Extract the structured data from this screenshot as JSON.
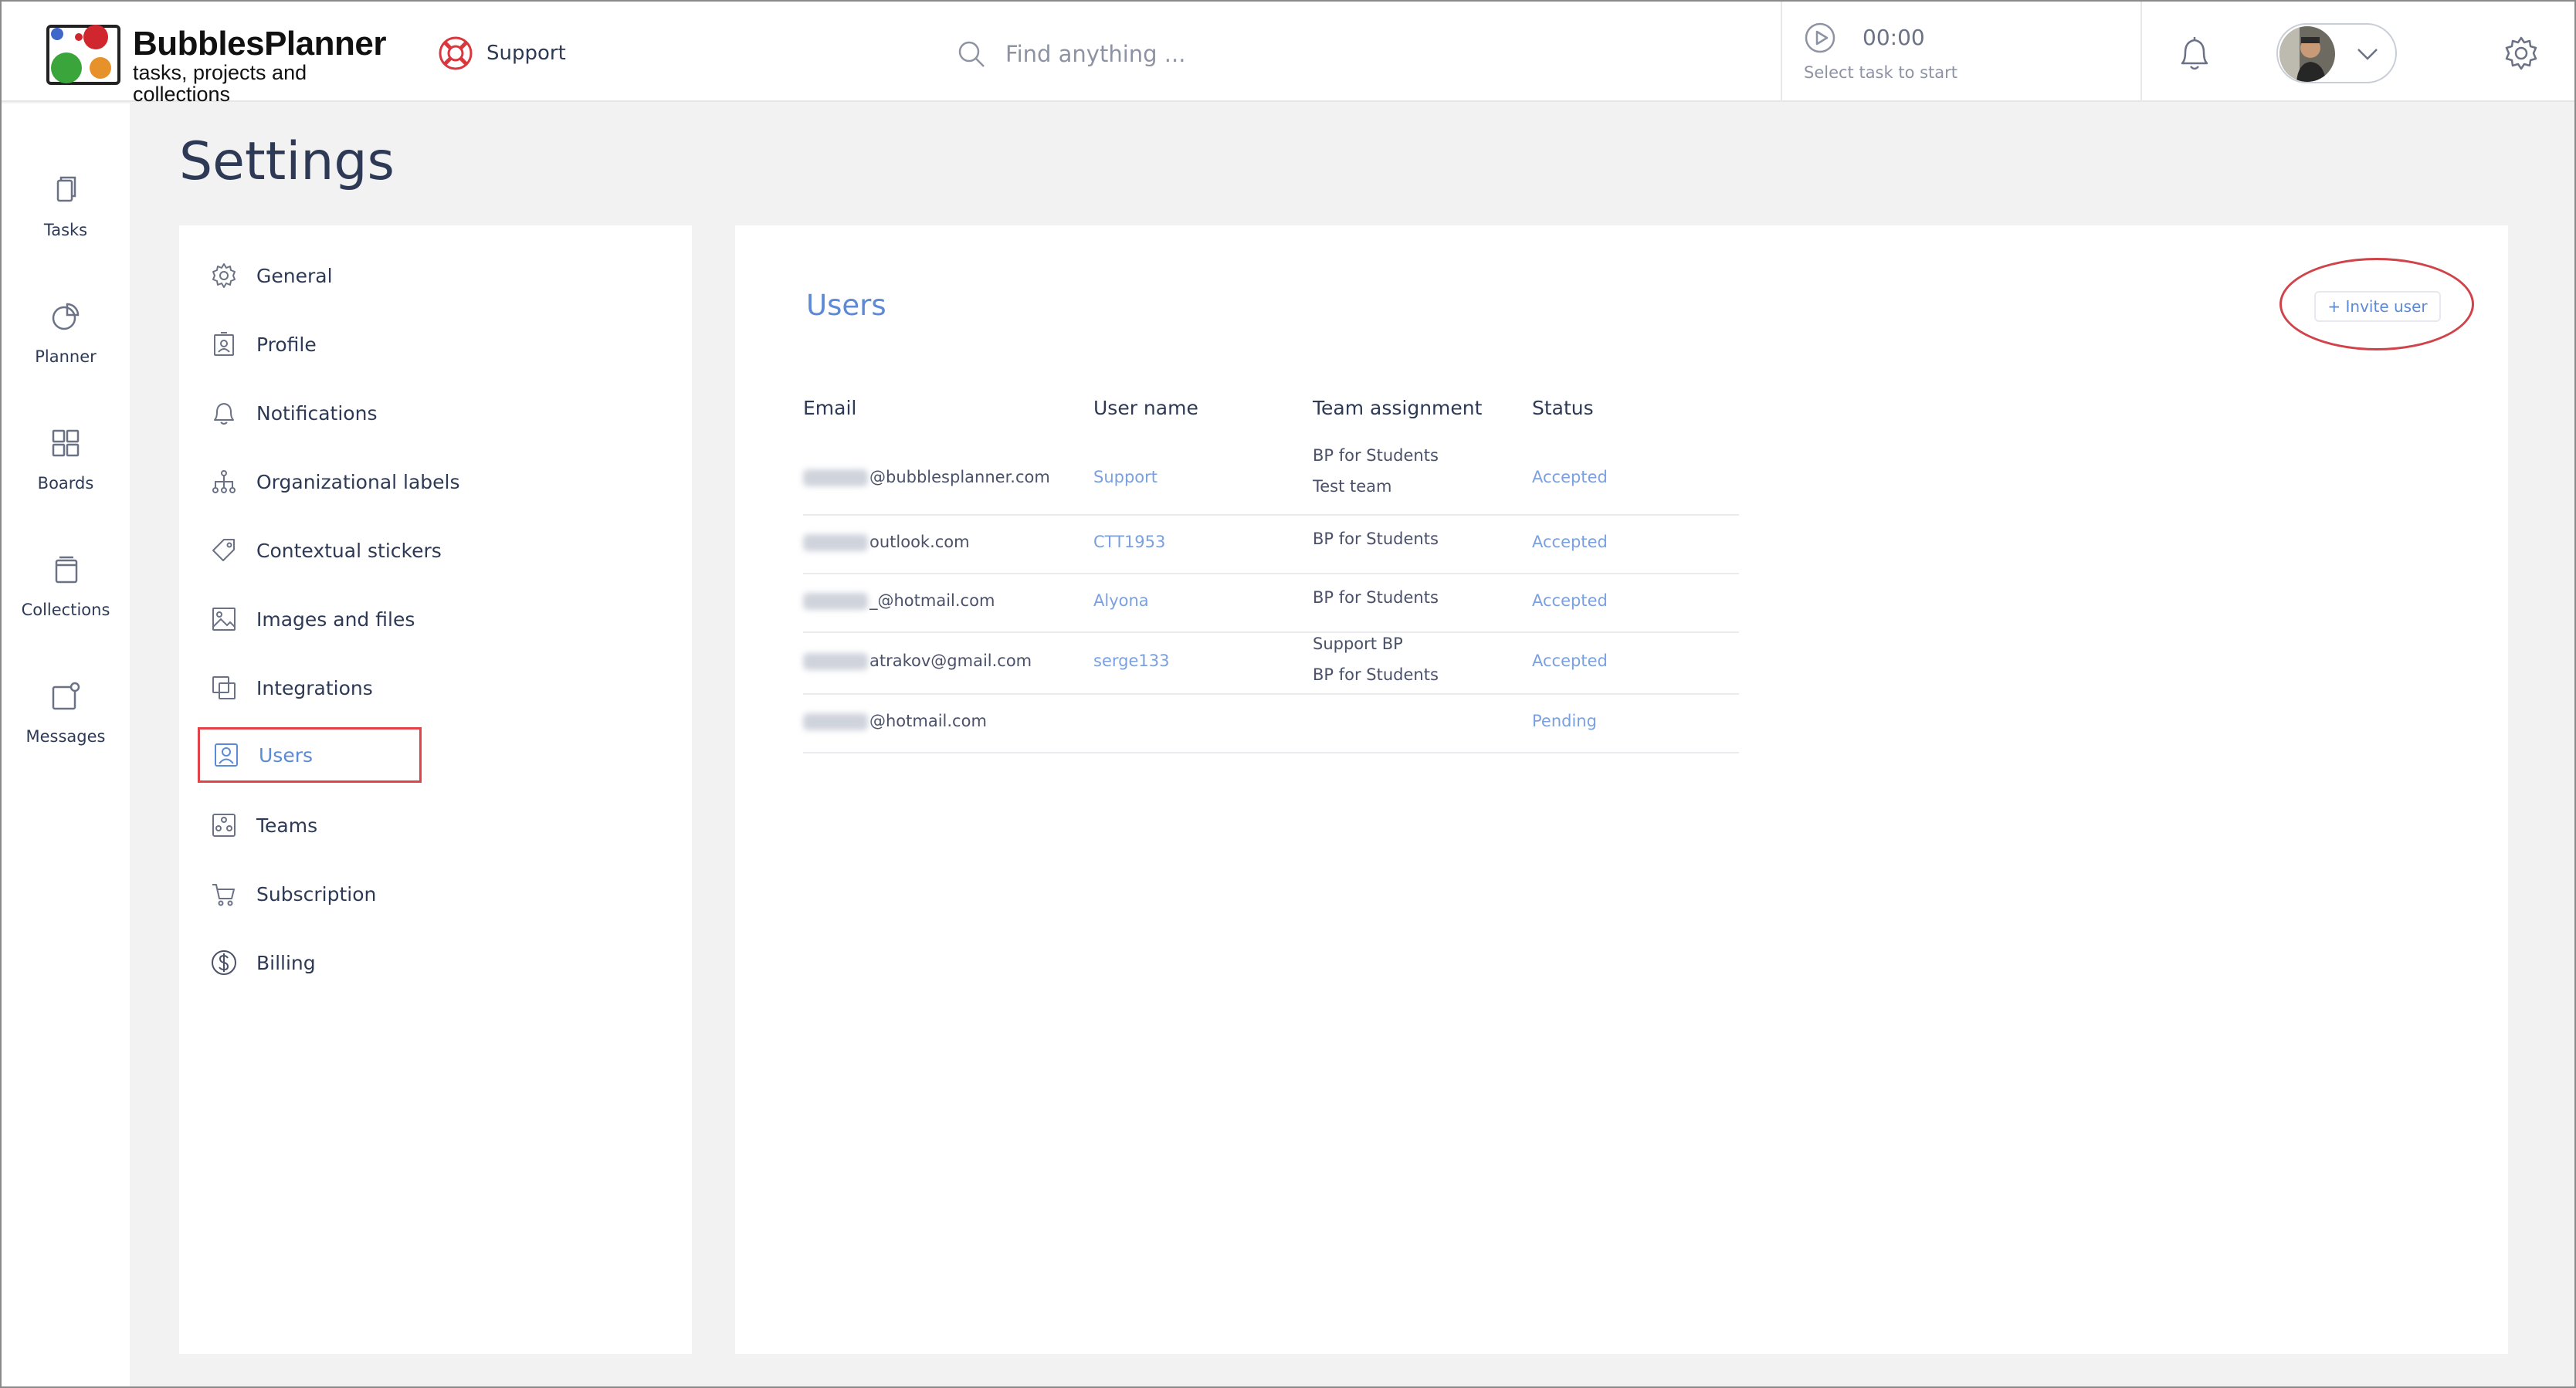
{
  "header": {
    "logo_title": "BubblesPlanner",
    "logo_subtitle": "tasks, projects and collections",
    "support_label": "Support",
    "search_placeholder": "Find anything ...",
    "timer_time": "00:00",
    "timer_hint": "Select task to start"
  },
  "leftnav": {
    "items": [
      {
        "label": "Tasks",
        "icon": "tasks-icon"
      },
      {
        "label": "Planner",
        "icon": "planner-icon"
      },
      {
        "label": "Boards",
        "icon": "boards-icon"
      },
      {
        "label": "Collections",
        "icon": "collections-icon"
      },
      {
        "label": "Messages",
        "icon": "messages-icon"
      }
    ]
  },
  "page": {
    "title": "Settings"
  },
  "settings_menu": {
    "items": [
      {
        "label": "General",
        "icon": "gear-icon"
      },
      {
        "label": "Profile",
        "icon": "profile-icon"
      },
      {
        "label": "Notifications",
        "icon": "bell-icon"
      },
      {
        "label": "Organizational labels",
        "icon": "hierarchy-icon"
      },
      {
        "label": "Contextual stickers",
        "icon": "tag-icon"
      },
      {
        "label": "Images and files",
        "icon": "image-icon"
      },
      {
        "label": "Integrations",
        "icon": "integrations-icon"
      },
      {
        "label": "Users",
        "icon": "user-icon",
        "active": true
      },
      {
        "label": "Teams",
        "icon": "teams-icon"
      },
      {
        "label": "Subscription",
        "icon": "cart-icon"
      },
      {
        "label": "Billing",
        "icon": "dollar-icon"
      }
    ]
  },
  "users": {
    "title": "Users",
    "invite_label": "+ Invite user",
    "columns": [
      "Email",
      "User name",
      "Team assignment",
      "Status"
    ],
    "rows": [
      {
        "email": "@bubblesplanner.com",
        "username": "Support",
        "teams": [
          "BP for Students",
          "Test team"
        ],
        "status": "Accepted"
      },
      {
        "email": "outlook.com",
        "username": "CTT1953",
        "teams": [
          "BP for Students"
        ],
        "status": "Accepted"
      },
      {
        "email": "_@hotmail.com",
        "username": "Alyona",
        "teams": [
          "BP for Students"
        ],
        "status": "Accepted"
      },
      {
        "email": "atrakov@gmail.com",
        "username": "serge133",
        "teams": [
          "Support BP",
          "BP for Students"
        ],
        "status": "Accepted"
      },
      {
        "email": "@hotmail.com",
        "username": "",
        "teams": [],
        "status": "Pending"
      }
    ]
  },
  "colors": {
    "accent": "#5b8ad6",
    "link": "#7aa0e0",
    "text": "#2e3a55",
    "highlight": "#e0434a"
  }
}
